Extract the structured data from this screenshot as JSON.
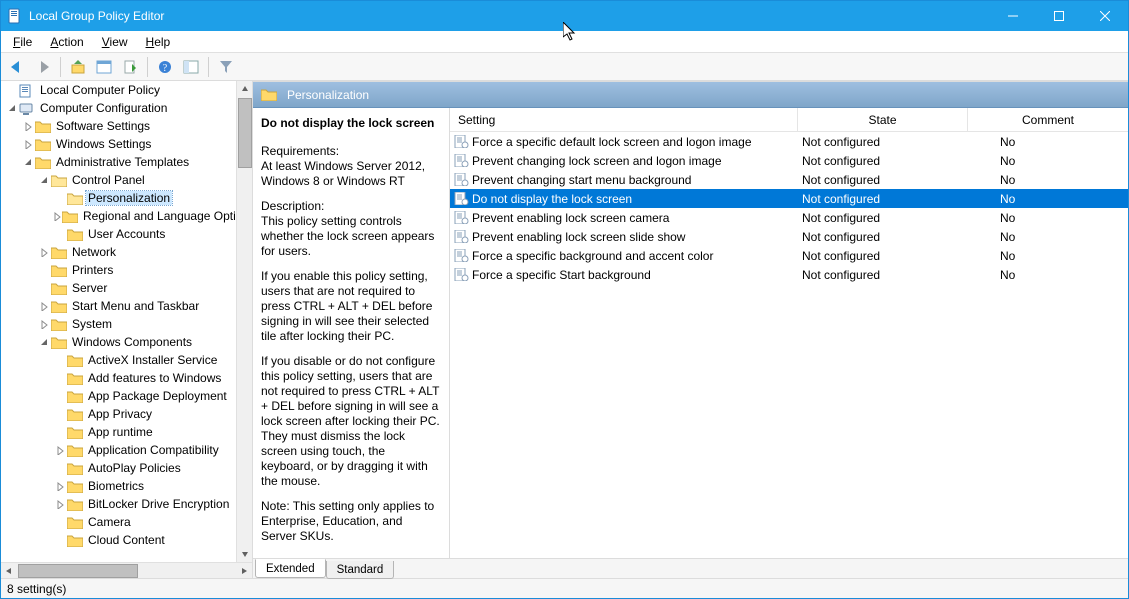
{
  "window": {
    "title": "Local Group Policy Editor"
  },
  "menu": {
    "file": {
      "label": "File",
      "accel": "F"
    },
    "action": {
      "label": "Action",
      "accel": "A"
    },
    "view": {
      "label": "View",
      "accel": "V"
    },
    "help": {
      "label": "Help",
      "accel": "H"
    }
  },
  "toolbar_icons": [
    "back",
    "forward",
    "up",
    "properties",
    "refresh",
    "help",
    "show-hide",
    "filter"
  ],
  "tree": {
    "root": "Local Computer Policy",
    "cc": "Computer Configuration",
    "sw": "Software Settings",
    "ws": "Windows Settings",
    "at": "Administrative Templates",
    "cp": "Control Panel",
    "pers": "Personalization",
    "rlo": "Regional and Language Options",
    "ua": "User Accounts",
    "net": "Network",
    "prn": "Printers",
    "srv": "Server",
    "smt": "Start Menu and Taskbar",
    "sys": "System",
    "wc": "Windows Components",
    "wc_items": [
      "ActiveX Installer Service",
      "Add features to Windows",
      "App Package Deployment",
      "App Privacy",
      "App runtime",
      "Application Compatibility",
      "AutoPlay Policies",
      "Biometrics",
      "BitLocker Drive Encryption",
      "Camera",
      "Cloud Content"
    ]
  },
  "content": {
    "header": "Personalization",
    "selected_title": "Do not display the lock screen",
    "req_label": "Requirements:",
    "req_text": "At least Windows Server 2012, Windows 8 or Windows RT",
    "desc_label": "Description:",
    "desc_p1": "This policy setting controls whether the lock screen appears for users.",
    "desc_p2": "If you enable this policy setting, users that are not required to press CTRL + ALT + DEL before signing in will see their selected tile after locking their PC.",
    "desc_p3": "If you disable or do not configure this policy setting, users that are not required to press CTRL + ALT + DEL before signing in will see a lock screen after locking their PC. They must dismiss the lock screen using touch, the keyboard, or by dragging it with the mouse.",
    "desc_p4": "Note: This setting only applies to Enterprise, Education, and Server SKUs."
  },
  "columns": {
    "setting": "Setting",
    "state": "State",
    "comment": "Comment"
  },
  "rows": [
    {
      "setting": "Force a specific default lock screen and logon image",
      "state": "Not configured",
      "comment": "No",
      "selected": false
    },
    {
      "setting": "Prevent changing lock screen and logon image",
      "state": "Not configured",
      "comment": "No",
      "selected": false
    },
    {
      "setting": "Prevent changing start menu background",
      "state": "Not configured",
      "comment": "No",
      "selected": false
    },
    {
      "setting": "Do not display the lock screen",
      "state": "Not configured",
      "comment": "No",
      "selected": true
    },
    {
      "setting": "Prevent enabling lock screen camera",
      "state": "Not configured",
      "comment": "No",
      "selected": false
    },
    {
      "setting": "Prevent enabling lock screen slide show",
      "state": "Not configured",
      "comment": "No",
      "selected": false
    },
    {
      "setting": "Force a specific background and accent color",
      "state": "Not configured",
      "comment": "No",
      "selected": false
    },
    {
      "setting": "Force a specific Start background",
      "state": "Not configured",
      "comment": "No",
      "selected": false
    }
  ],
  "tabs": {
    "extended": "Extended",
    "standard": "Standard"
  },
  "status": "8 setting(s)"
}
